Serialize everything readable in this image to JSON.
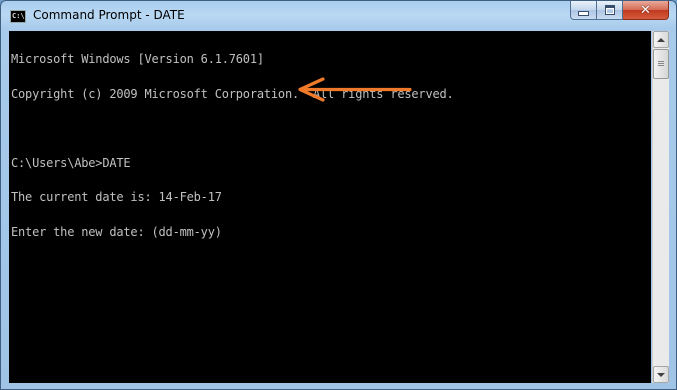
{
  "window": {
    "title": "Command Prompt - DATE",
    "app_icon_text": "C:\\",
    "controls": {
      "minimize": "minimize",
      "maximize": "maximize",
      "close": "✕"
    }
  },
  "console": {
    "lines": [
      "Microsoft Windows [Version 6.1.7601]",
      "Copyright (c) 2009 Microsoft Corporation.  All rights reserved.",
      "",
      "C:\\Users\\Abe>DATE",
      "The current date is: 14-Feb-17",
      "Enter the new date: (dd-mm-yy)"
    ],
    "text_color": "#c0c0c0",
    "background_color": "#000000"
  },
  "annotation": {
    "icon": "arrow-left-icon",
    "color": "#f07a2a"
  },
  "scrollbar": {
    "up_icon": "scroll-up-icon",
    "down_icon": "scroll-down-icon"
  }
}
